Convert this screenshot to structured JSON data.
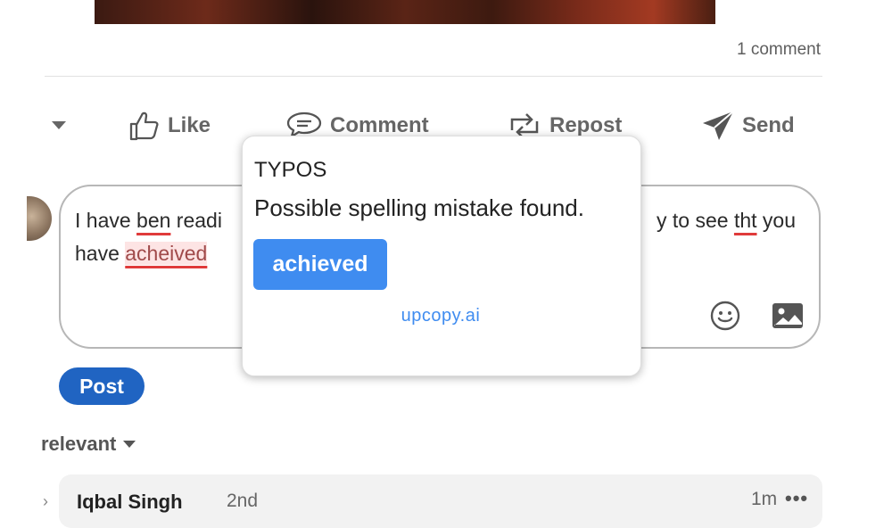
{
  "post": {
    "comment_count": "1 comment"
  },
  "actions": {
    "like": "Like",
    "comment": "Comment",
    "repost": "Repost",
    "send": "Send"
  },
  "composer": {
    "line1_start": "I have ",
    "line1_typo1": "ben",
    "line1_mid": " readi",
    "line1_right_pre": "y to see ",
    "line1_typo2": "tht",
    "line1_right_post": " you",
    "line2_start": "have ",
    "line2_typo": "acheived"
  },
  "post_button": "Post",
  "sort": {
    "label": "relevant"
  },
  "comment": {
    "name": "Iqbal Singh",
    "degree": "2nd",
    "time": "1m",
    "more": "•••"
  },
  "popup": {
    "category": "TYPOS",
    "message": "Possible spelling mistake found.",
    "suggestion": "achieved",
    "brand": "upcopy.ai"
  },
  "colors": {
    "accent": "#3f8cf0",
    "post_button": "#2064c2",
    "typo_underline": "#e03b3b"
  }
}
